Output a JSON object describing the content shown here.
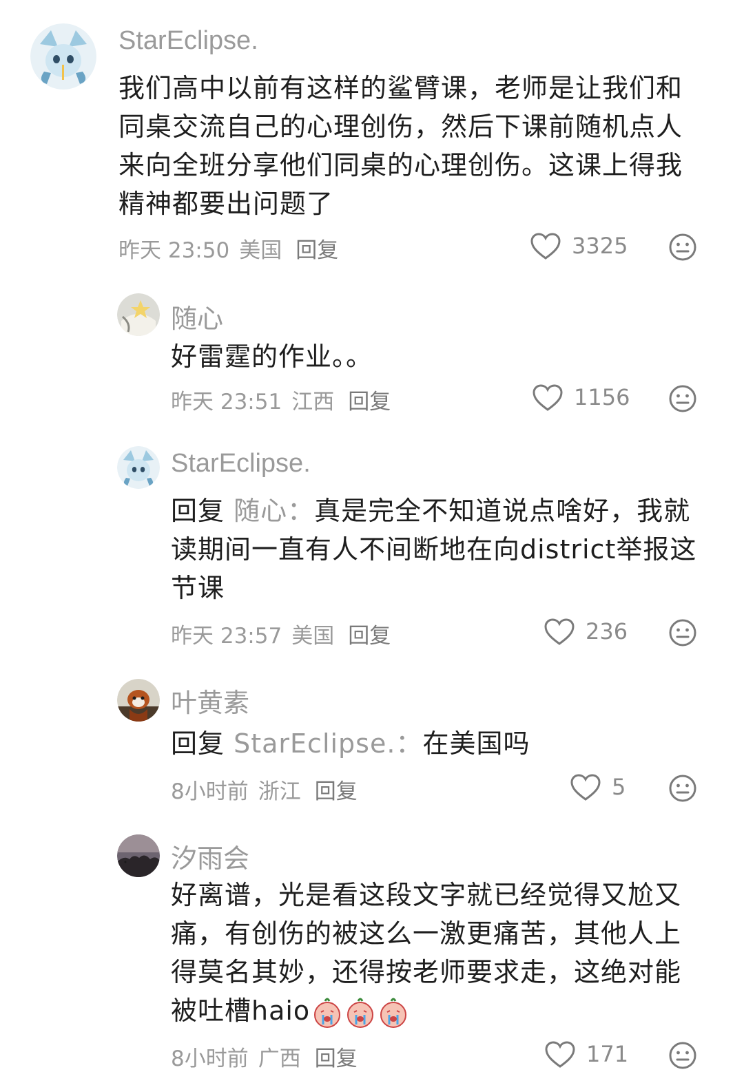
{
  "comments": [
    {
      "username": "StarEclipse.",
      "text": "我们高中以前有这样的鲨臂课，老师是让我们和同桌交流自己的心理创伤，然后下课前随机点人来向全班分享他们同桌的心理创伤。这课上得我精神都要出问题了",
      "time": "昨天 23:50",
      "location": "美国",
      "reply_label": "回复",
      "likes": "3325"
    },
    {
      "username": "随心",
      "text": "好雷霆的作业。。",
      "time": "昨天 23:51",
      "location": "江西",
      "reply_label": "回复",
      "likes": "1156"
    },
    {
      "username": "StarEclipse.",
      "reply_prefix": "回复",
      "reply_target": "随心：",
      "text": "真是完全不知道说点啥好，我就读期间一直有人不间断地在向district举报这节课",
      "time": "昨天 23:57",
      "location": "美国",
      "reply_label": "回复",
      "likes": "236"
    },
    {
      "username": "叶黄素",
      "reply_prefix": "回复",
      "reply_target": "StarEclipse.：",
      "text": "在美国吗",
      "time": "8小时前",
      "location": "浙江",
      "reply_label": "回复",
      "likes": "5"
    },
    {
      "username": "汐雨会",
      "text": "好离谱，光是看这段文字就已经觉得又尬又痛，有创伤的被这么一激更痛苦，其他人上得莫名其妙，还得按老师要求走，这绝对能被吐槽haio",
      "emojis": [
        "crying-emoji",
        "crying-emoji",
        "crying-emoji"
      ],
      "time": "8小时前",
      "location": "广西",
      "reply_label": "回复",
      "likes": "171"
    }
  ],
  "icons": {
    "like": "heart-outline-icon",
    "react": "neutral-face-icon",
    "emoji": "crying-emoji"
  }
}
